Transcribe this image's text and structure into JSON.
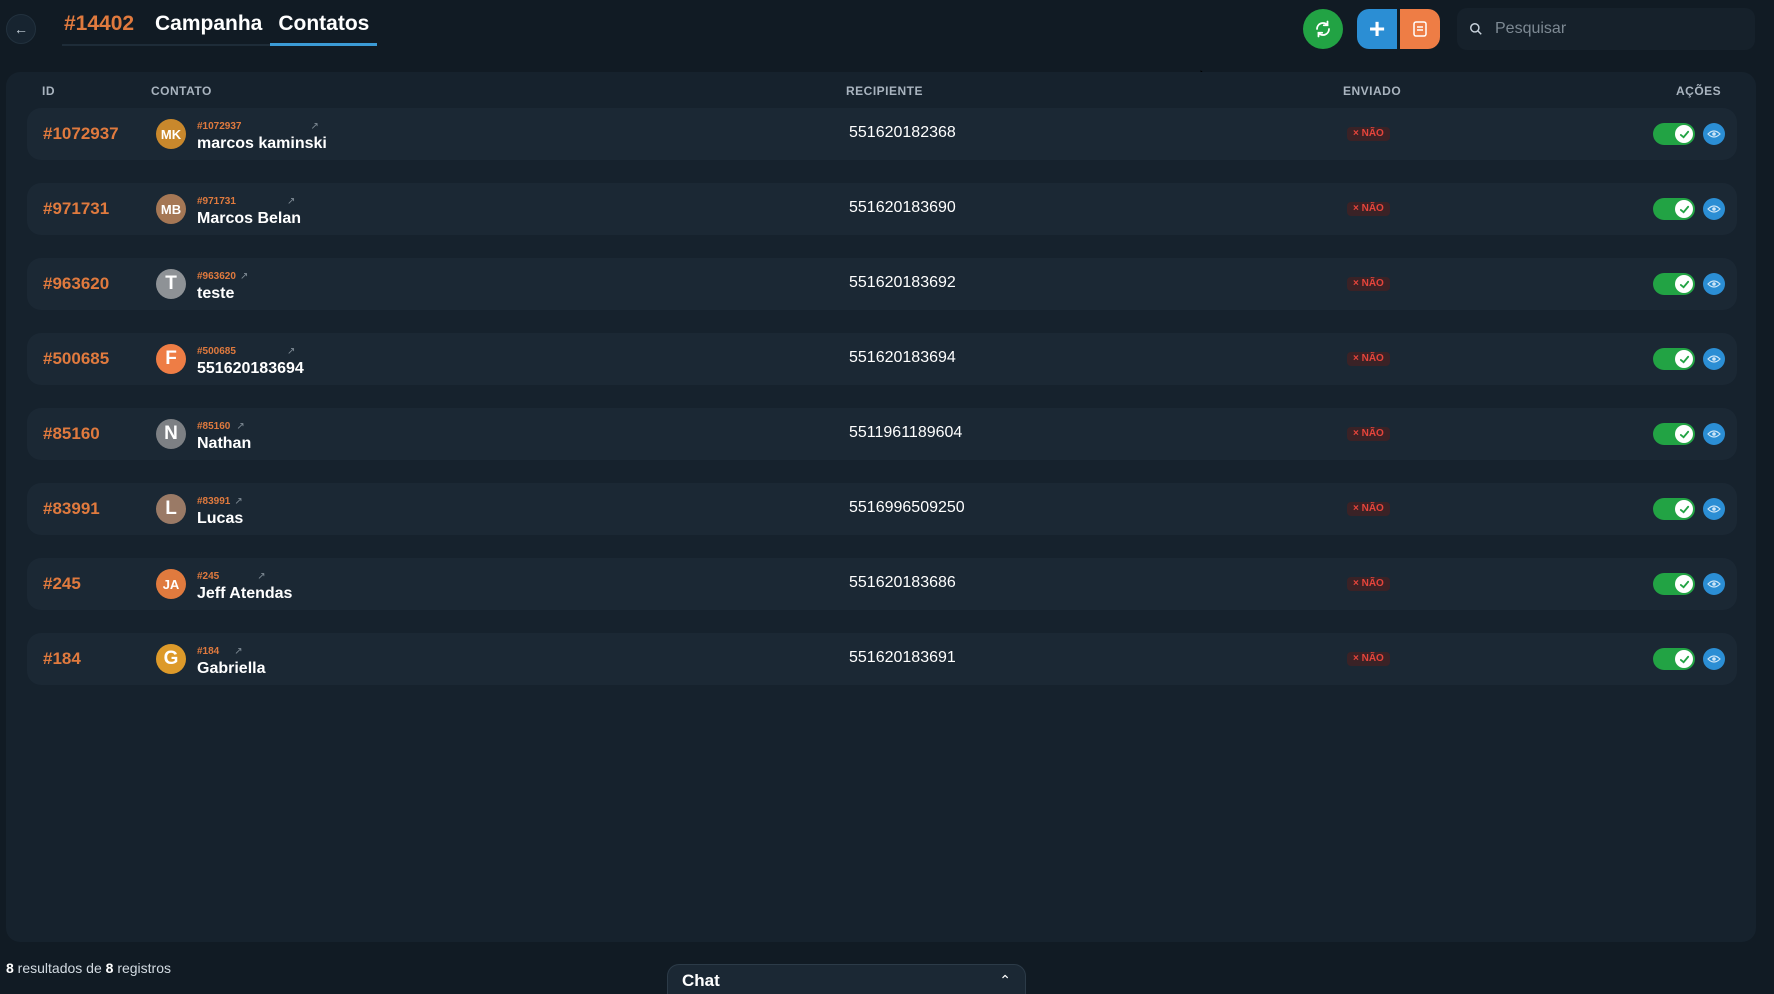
{
  "header": {
    "back_icon": "arrow-left-icon",
    "tabs": [
      {
        "label": "#14402"
      },
      {
        "label": "Campanha"
      },
      {
        "label": "Contatos"
      }
    ],
    "buttons": {
      "refresh_icon": "refresh-icon",
      "add_label": "+",
      "doc_icon": "document-icon"
    },
    "search": {
      "placeholder": "Pesquisar",
      "value": ""
    }
  },
  "table": {
    "columns": {
      "id": "ID",
      "contact": "CONTATO",
      "recipient": "RECIPIENTE",
      "sent": "ENVIADO",
      "actions": "AÇÕES"
    },
    "rows": [
      {
        "id": "#1072937",
        "initials": "MK",
        "avatar_color": "#c9882c",
        "sub_id": "#1072937",
        "name": "marcos kaminski",
        "phone": "551620182368",
        "sent": "× NÃO",
        "active": true
      },
      {
        "id": "#971731",
        "initials": "MB",
        "avatar_color": "#a57755",
        "sub_id": "#971731",
        "name": "Marcos Belan",
        "phone": "551620183690",
        "sent": "× NÃO",
        "active": true
      },
      {
        "id": "#963620",
        "initials": "T",
        "avatar_color": "#8e9296",
        "sub_id": "#963620",
        "name": "teste",
        "phone": "551620183692",
        "sent": "× NÃO",
        "active": true
      },
      {
        "id": "#500685",
        "initials": "F",
        "avatar_color": "#ee7d45",
        "sub_id": "#500685",
        "name": "551620183694",
        "phone": "551620183694",
        "sent": "× NÃO",
        "active": true
      },
      {
        "id": "#85160",
        "initials": "N",
        "avatar_color": "#7d8084",
        "sub_id": "#85160",
        "name": "Nathan",
        "phone": "5511961189604",
        "sent": "× NÃO",
        "active": true
      },
      {
        "id": "#83991",
        "initials": "L",
        "avatar_color": "#9a7a66",
        "sub_id": "#83991",
        "name": "Lucas",
        "phone": "5516996509250",
        "sent": "× NÃO",
        "active": true
      },
      {
        "id": "#245",
        "initials": "JA",
        "avatar_color": "#e07a3e",
        "sub_id": "#245",
        "name": "Jeff Atendas",
        "phone": "551620183686",
        "sent": "× NÃO",
        "active": true
      },
      {
        "id": "#184",
        "initials": "G",
        "avatar_color": "#dd9a2a",
        "sub_id": "#184",
        "name": "Gabriella",
        "phone": "551620183691",
        "sent": "× NÃO",
        "active": true
      }
    ]
  },
  "footer": {
    "count": "8",
    "text_mid": " resultados de ",
    "total": "8",
    "text_end": " registros"
  },
  "chat": {
    "label": "Chat",
    "chevron_icon": "chevron-up-icon"
  },
  "colors": {
    "accent_orange": "#e07a3e",
    "accent_blue": "#2b8ed4",
    "success_green": "#22a344",
    "danger_red": "#e6453c"
  }
}
